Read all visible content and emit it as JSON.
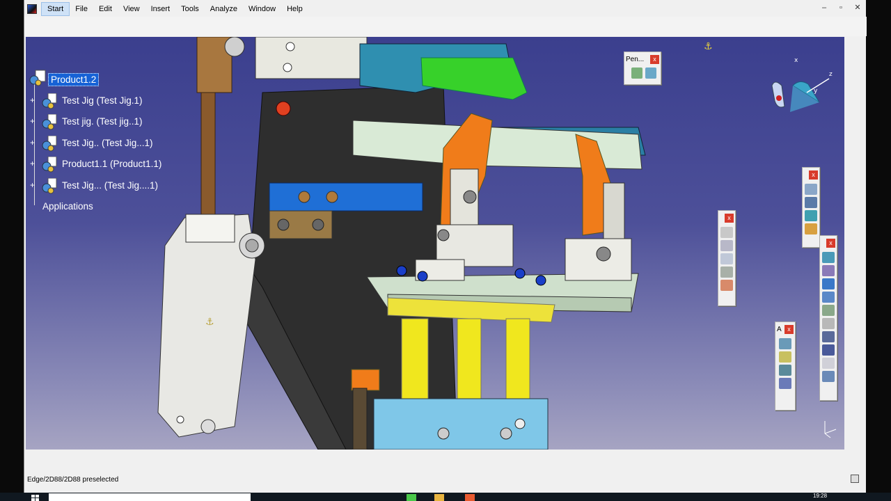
{
  "menu": {
    "items": [
      {
        "label": "Start",
        "active": true
      },
      {
        "label": "File"
      },
      {
        "label": "Edit"
      },
      {
        "label": "View"
      },
      {
        "label": "Insert"
      },
      {
        "label": "Tools"
      },
      {
        "label": "Analyze"
      },
      {
        "label": "Window"
      },
      {
        "label": "Help"
      }
    ]
  },
  "window_controls": {
    "minimize": "–",
    "restore": "▫",
    "close": "✕"
  },
  "tree": {
    "root": "Product1.2",
    "nodes": [
      "Test Jig (Test Jig.1)",
      "Test jig. (Test jig..1)",
      "Test Jig.. (Test Jig...1)",
      "Product1.1 (Product1.1)",
      "Test Jig... (Test Jig....1)"
    ],
    "applications": "Applications"
  },
  "floating_toolbars": {
    "pen": {
      "title": "Pen..."
    },
    "a": {
      "title": "A"
    }
  },
  "status": {
    "text": "Edge/2D88/2D88 preselected"
  },
  "taskbar": {
    "clock": "19:28"
  },
  "colors": {
    "viewport_top": "#3b3f8e",
    "viewport_bottom": "#a6a4c2",
    "selection": "#1662d6",
    "close": "#d83b2b"
  },
  "icons": [
    "app-logo-icon",
    "gear-product-icon",
    "compass-icon",
    "close-icon",
    "windows-start-icon"
  ]
}
